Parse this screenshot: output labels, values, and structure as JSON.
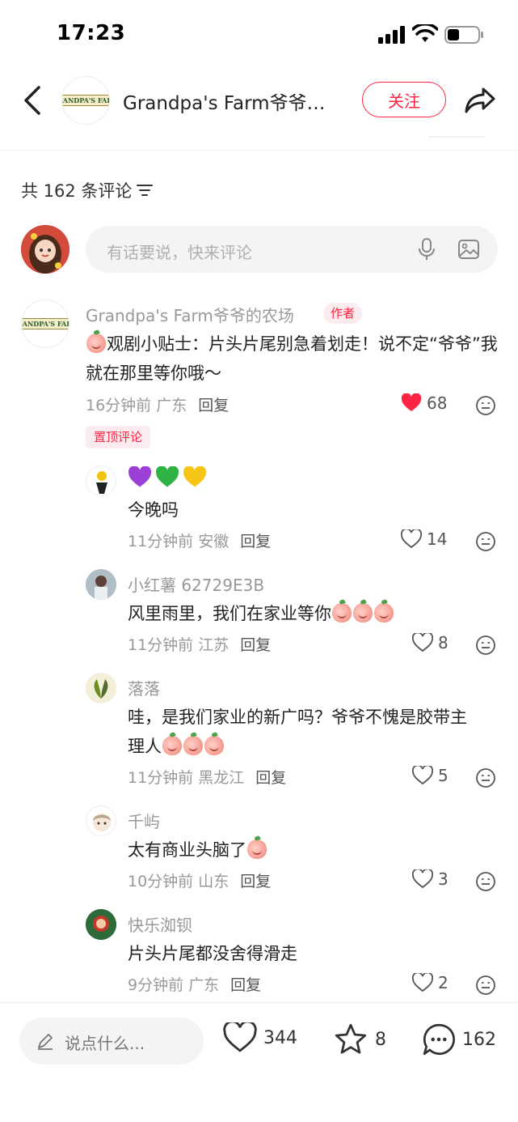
{
  "status_bar": {
    "time": "17:23"
  },
  "header": {
    "logo_text": "GRANDPA'S FARM",
    "title": "Grandpa's Farm爷爷…",
    "follow_label": "关注"
  },
  "comments_header": {
    "count_label": "共 162 条评论"
  },
  "composer": {
    "placeholder": "有话要说，快来评论"
  },
  "comments": [
    {
      "name": "Grandpa's Farm爷爷的农场",
      "badge": "作者",
      "text": "观剧小贴士：片头片尾别急着划走！说不定“爷爷”我就在那里等你哦～",
      "time": "16分钟前",
      "location": "广东",
      "reply": "回复",
      "likes": "68",
      "liked": true,
      "pin_label": "置顶评论"
    },
    {
      "name": "",
      "text": "今晚吗",
      "time": "11分钟前",
      "location": "安徽",
      "reply": "回复",
      "likes": "14"
    },
    {
      "name": "小红薯 62729E3B",
      "text": "风里雨里，我们在家业等你",
      "time": "11分钟前",
      "location": "江苏",
      "reply": "回复",
      "likes": "8"
    },
    {
      "name": "落落",
      "text_line1": "哇，是我们家业的新广吗？爷爷不愧是胶带主",
      "text_line2": "理人",
      "time": "11分钟前",
      "location": "黑龙江",
      "reply": "回复",
      "likes": "5"
    },
    {
      "name": "千屿",
      "text": "太有商业头脑了",
      "time": "10分钟前",
      "location": "山东",
      "reply": "回复",
      "likes": "3"
    },
    {
      "name": "快乐洳钡",
      "text": "片头片尾都没舍得滑走",
      "time": "9分钟前",
      "location": "广东",
      "reply": "回复",
      "likes": "2"
    }
  ],
  "bottom_bar": {
    "say_placeholder": "说点什么...",
    "likes": "344",
    "stars": "8",
    "comments": "162"
  },
  "colors": {
    "accent": "#ff2442",
    "liked_heart": "#ff2442",
    "muted_text": "#999999"
  },
  "icons": [
    "back-icon",
    "share-icon",
    "filter-icon",
    "mic-icon",
    "image-icon",
    "heart-icon",
    "emoji-icon",
    "pen-icon",
    "star-icon",
    "comment-icon"
  ]
}
